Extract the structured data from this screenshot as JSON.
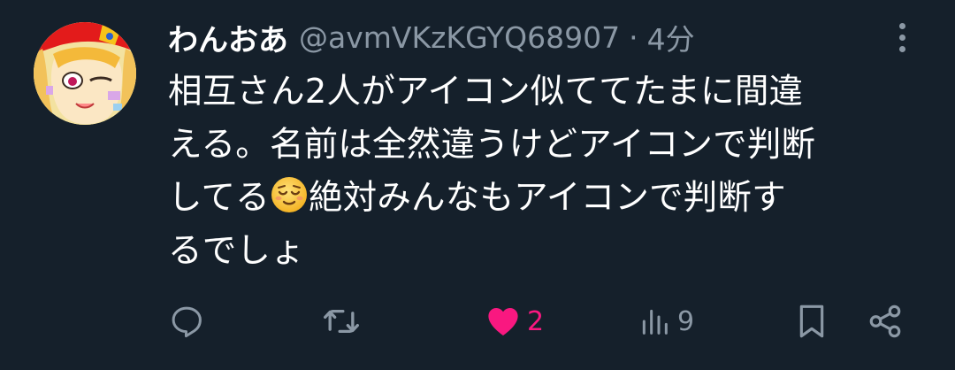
{
  "tweet": {
    "display_name": "わんおあ",
    "handle": "@avmVKzKGYQ68907",
    "separator": "·",
    "time": "4分",
    "text_lines": [
      "相互さん2人がアイコン似ててたまに間違",
      "える。名前は全然違うけどアイコンで判断",
      "してる",
      "絶対みんなもアイコンで判断す",
      "るでしょ"
    ],
    "emoji": "relieved-face-emoji"
  },
  "actions": {
    "reply_icon": "reply-icon",
    "retweet_icon": "retweet-icon",
    "like_icon": "heart-icon",
    "like_count": "2",
    "views_icon": "views-icon",
    "views_count": "9",
    "bookmark_icon": "bookmark-icon",
    "share_icon": "share-icon"
  },
  "colors": {
    "background": "#15202b",
    "text": "#ffffff",
    "muted": "#8b98a5",
    "like": "#f91880"
  }
}
